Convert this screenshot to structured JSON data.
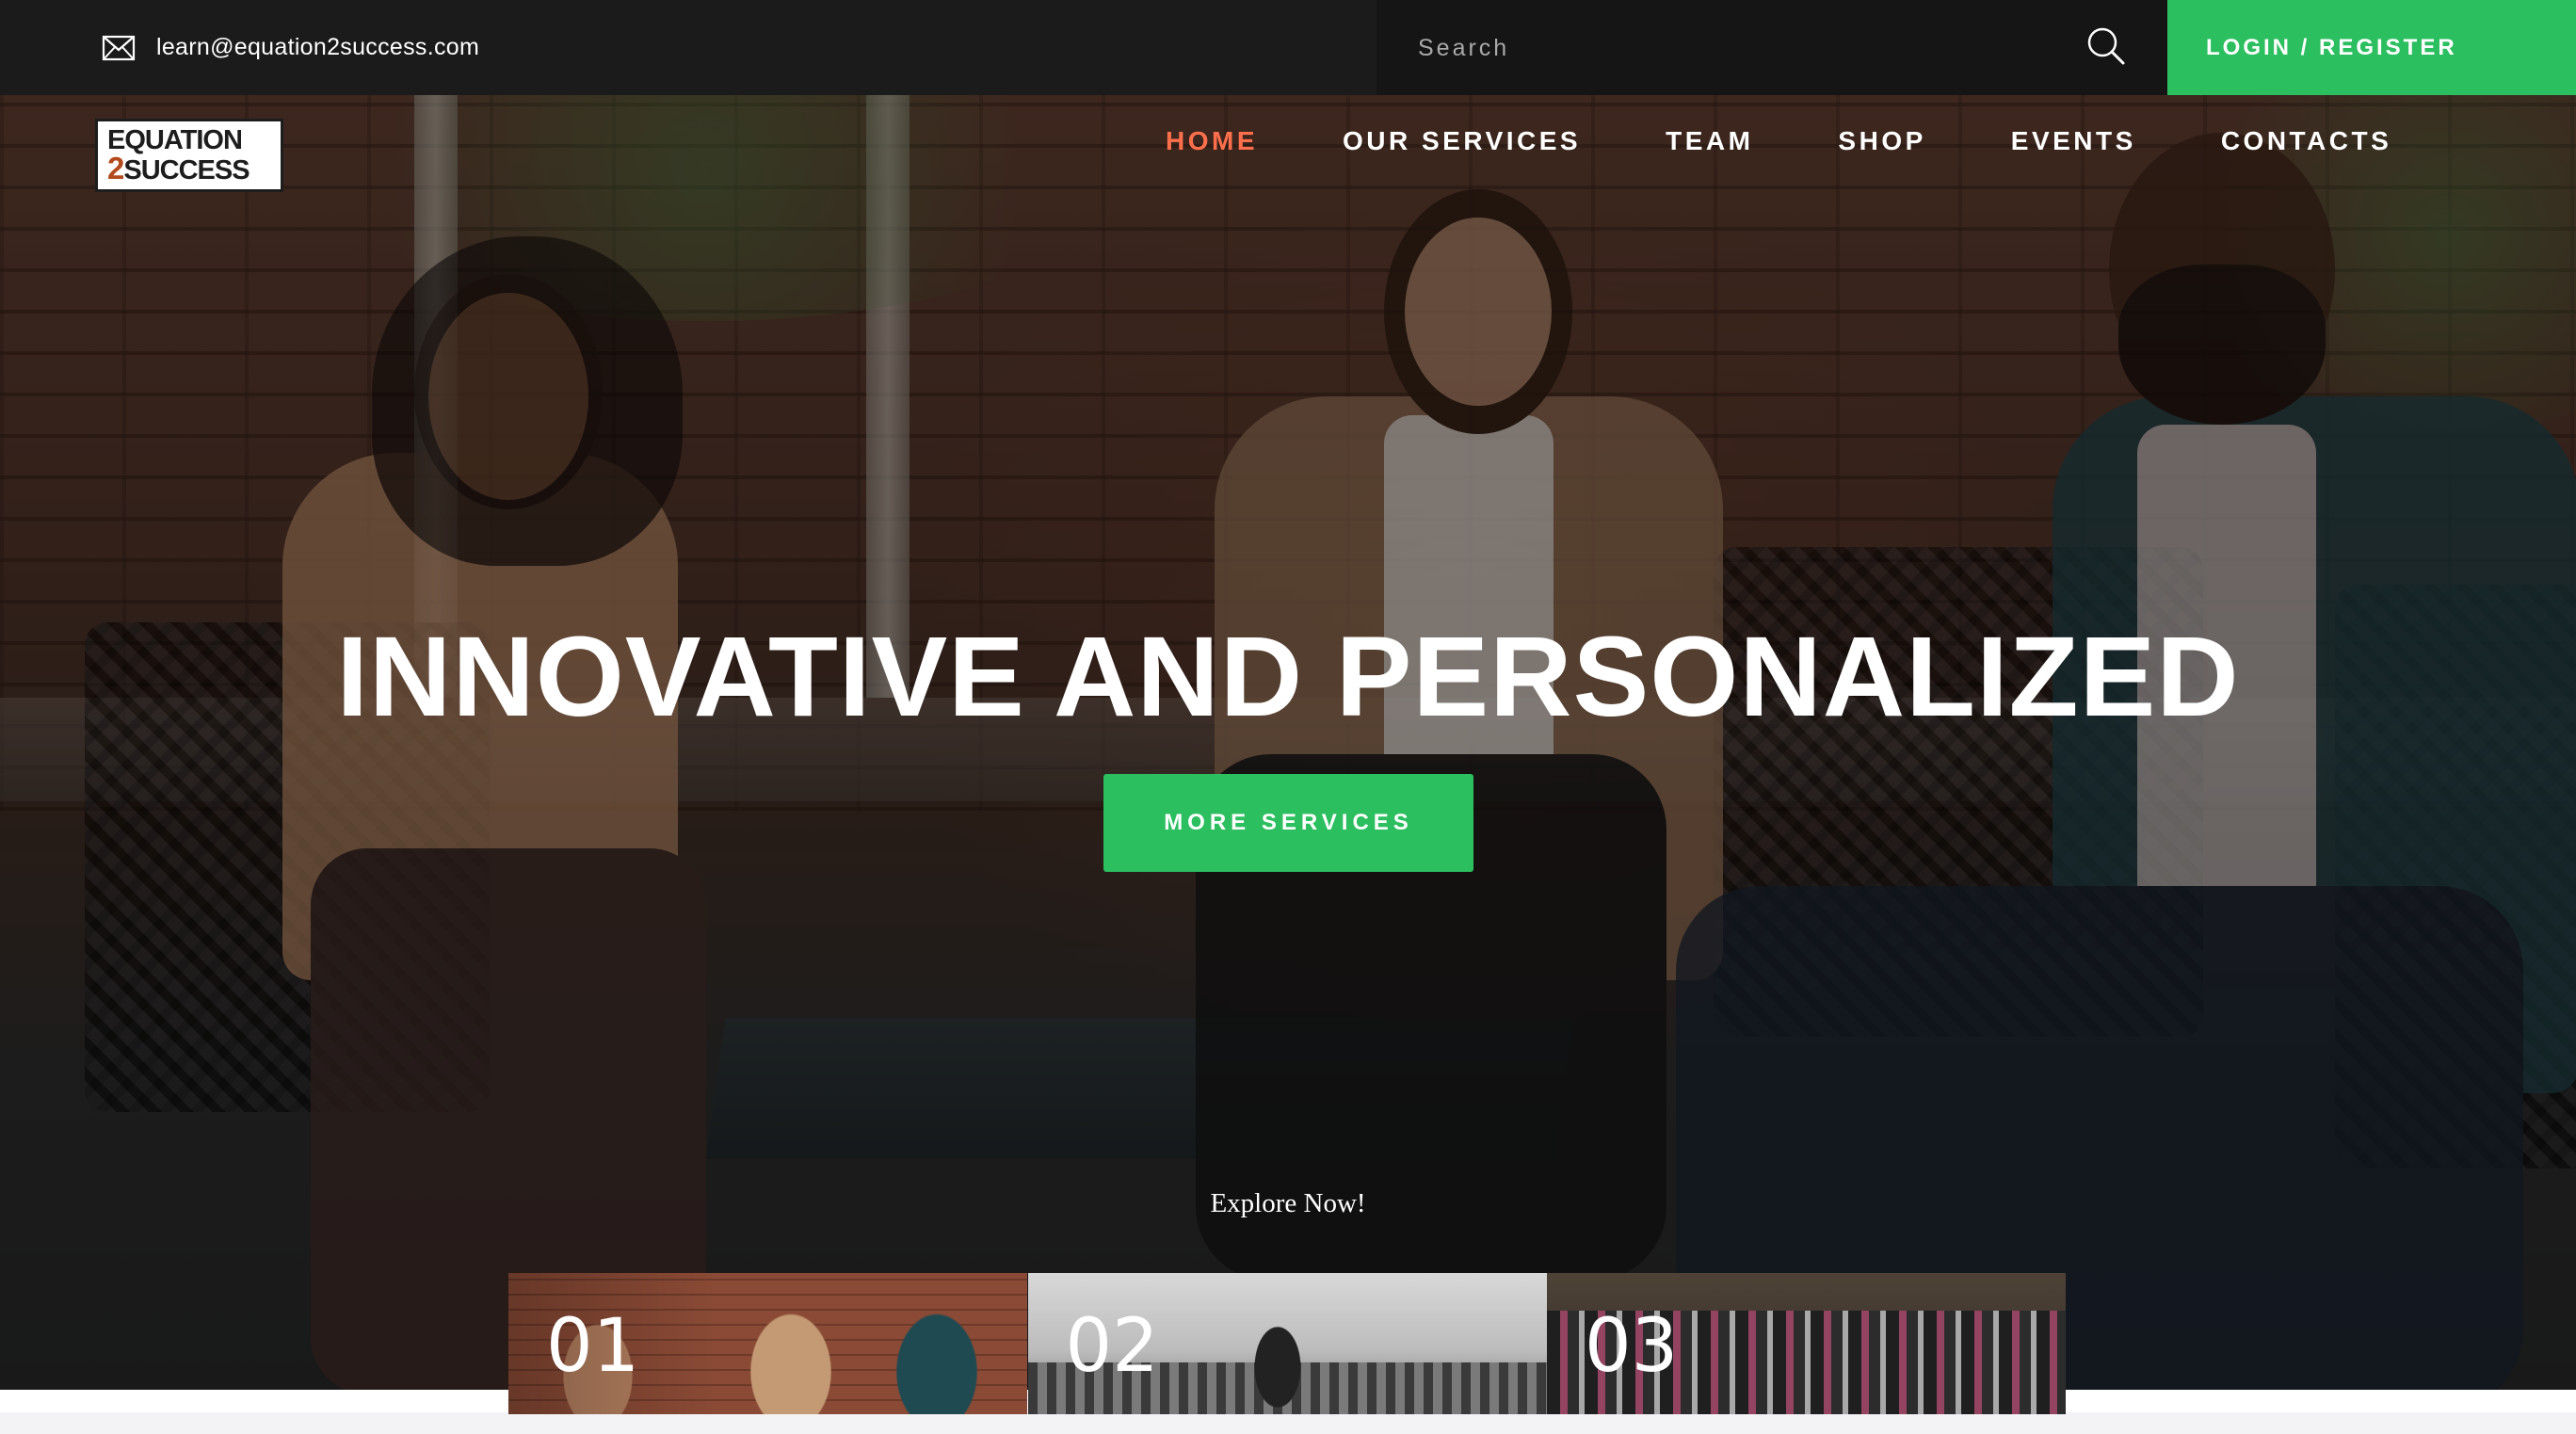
{
  "topbar": {
    "email": "learn@equation2success.com",
    "email_icon": "envelope-icon",
    "search_placeholder": "Search",
    "search_icon": "search-icon",
    "login_label": "LOGIN / REGISTER"
  },
  "logo": {
    "line1": "EQUATION",
    "line2_num": "2",
    "line2_text": "SUCCESS"
  },
  "nav": {
    "items": [
      {
        "label": "HOME",
        "active": true
      },
      {
        "label": "OUR SERVICES",
        "active": false
      },
      {
        "label": "TEAM",
        "active": false
      },
      {
        "label": "SHOP",
        "active": false
      },
      {
        "label": "EVENTS",
        "active": false
      },
      {
        "label": "CONTACTS",
        "active": false
      }
    ]
  },
  "hero": {
    "headline": "INNOVATIVE AND PERSONALIZED",
    "button_label": "MORE SERVICES",
    "explore_text": "Explore Now!"
  },
  "thumbnails": [
    {
      "number": "01"
    },
    {
      "number": "02"
    },
    {
      "number": "03"
    }
  ],
  "colors": {
    "accent_green": "#2cbf60",
    "nav_active": "#ff6f4b",
    "topbar_bg": "#1c1b1c"
  }
}
